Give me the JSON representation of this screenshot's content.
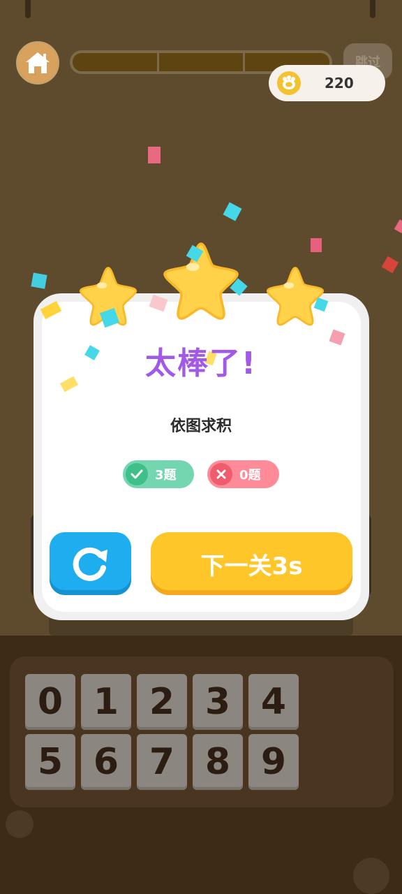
{
  "header": {
    "skip_label": "跳过",
    "coins": "220",
    "progress_segments": 3
  },
  "modal": {
    "title": "太棒了!",
    "level_name": "依图求积",
    "correct": "3题",
    "wrong": "0题",
    "next_label": "下一关3s",
    "stars_earned": 3
  },
  "keypad": {
    "keys": [
      "0",
      "1",
      "2",
      "3",
      "4",
      "5",
      "6",
      "7",
      "8",
      "9"
    ]
  },
  "colors": {
    "title": "#a259e6",
    "retry": "#1eaef0",
    "next": "#ffc629",
    "correct": "#74d6b1",
    "wrong": "#ff8b98",
    "star": "#ffd24a"
  },
  "icons": {
    "home": "home-icon",
    "coin": "coin-icon",
    "check": "check-icon",
    "cross": "cross-icon",
    "retry": "retry-icon",
    "star": "star-icon"
  }
}
